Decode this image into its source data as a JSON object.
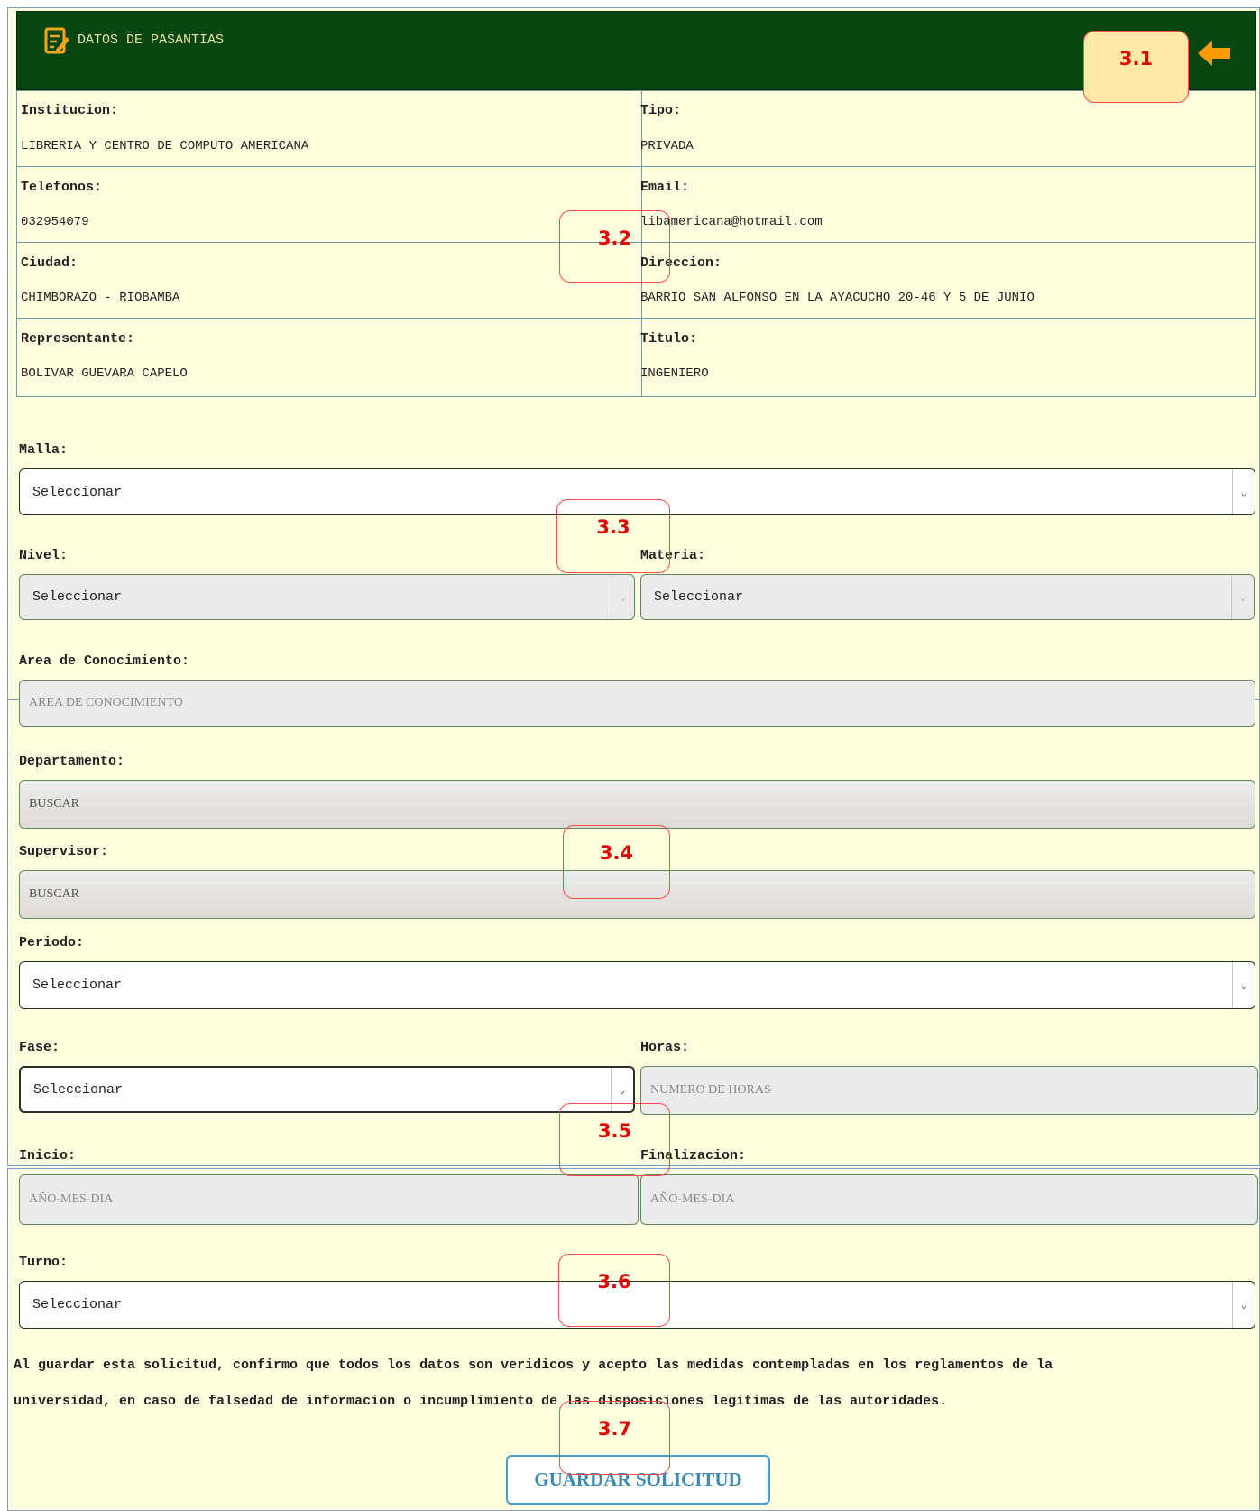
{
  "header": {
    "title": "DATOS DE PASANTIAS",
    "icon": "edit-document-icon",
    "back_icon": "arrow-left-icon",
    "accent": "#ff9a00"
  },
  "institution": {
    "institucion_label": "Institucion:",
    "institucion_value": "LIBRERIA Y CENTRO DE COMPUTO AMERICANA",
    "tipo_label": "Tipo:",
    "tipo_value": "PRIVADA",
    "telefonos_label": "Telefonos:",
    "telefonos_value": "032954079",
    "email_label": "Email:",
    "email_value": "libamericana@hotmail.com",
    "ciudad_label": "Ciudad:",
    "ciudad_value": "CHIMBORAZO - RIOBAMBA",
    "direccion_label": "Direccion:",
    "direccion_value": "BARRIO SAN ALFONSO EN LA AYACUCHO 20-46 Y 5 DE JUNIO",
    "representante_label": "Representante:",
    "representante_value": "BOLIVAR GUEVARA CAPELO",
    "titulo_label": "Titulo:",
    "titulo_value": "INGENIERO"
  },
  "form": {
    "malla_label": "Malla:",
    "malla_value": "Seleccionar",
    "nivel_label": "Nivel:",
    "nivel_value": "Seleccionar",
    "materia_label": "Materia:",
    "materia_value": "Seleccionar",
    "area_label": "Area de Conocimiento:",
    "area_placeholder": "AREA DE CONOCIMIENTO",
    "departamento_label": "Departamento:",
    "departamento_value": "BUSCAR",
    "supervisor_label": "Supervisor:",
    "supervisor_value": "BUSCAR",
    "periodo_label": "Periodo:",
    "periodo_value": "Seleccionar",
    "fase_label": "Fase:",
    "fase_value": "Seleccionar",
    "horas_label": "Horas:",
    "horas_placeholder": "NUMERO DE HORAS",
    "inicio_label": "Inicio:",
    "inicio_placeholder": "AÑO-MES-DIA",
    "finalizacion_label": "Finalizacion:",
    "finalizacion_placeholder": "AÑO-MES-DIA",
    "turno_label": "Turno:",
    "turno_value": "Seleccionar"
  },
  "disclaimer": {
    "line1": "Al guardar esta solicitud, confirmo que todos los datos son veridicos y acepto las medidas contempladas en los reglamentos de la",
    "line2": "universidad, en caso de falsedad de informacion o incumplimiento de las disposiciones legitimas de las autoridades."
  },
  "save_button": "GUARDAR SOLICITUD",
  "callouts": [
    "3.1",
    "3.2",
    "3.3",
    "3.4",
    "3.5",
    "3.6",
    "3.7"
  ]
}
